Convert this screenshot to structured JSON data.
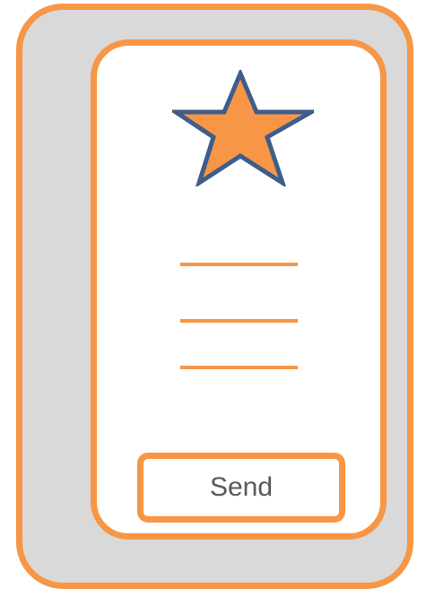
{
  "icons": {
    "header_icon": "star-icon"
  },
  "form": {
    "field_count": 3,
    "send_label": "Send"
  },
  "colors": {
    "accent": "#f79646",
    "frame_fill": "#d9d9d9",
    "screen_fill": "#ffffff",
    "star_fill": "#f79646",
    "star_outline": "#3f5d8a",
    "button_text": "#595959"
  }
}
